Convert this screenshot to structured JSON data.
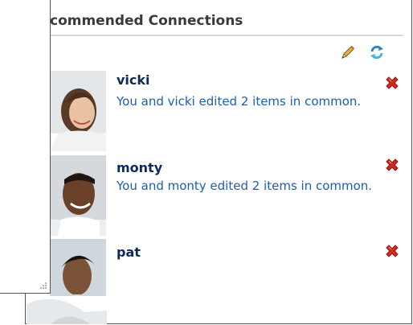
{
  "panel": {
    "title": "commended Connections"
  },
  "toolbar": {
    "edit_icon": "pencil-icon",
    "refresh_icon": "refresh-icon"
  },
  "connections": [
    {
      "name": "vicki",
      "description": "You and vicki edited 2 items in common."
    },
    {
      "name": "monty",
      "description": "You and monty edited 2 items in common."
    },
    {
      "name": "pat",
      "description": ""
    }
  ],
  "colors": {
    "name": "#0e2a5c",
    "description": "#1a5fb3",
    "remove": "#d22a1e",
    "title": "#3a3a3a"
  }
}
